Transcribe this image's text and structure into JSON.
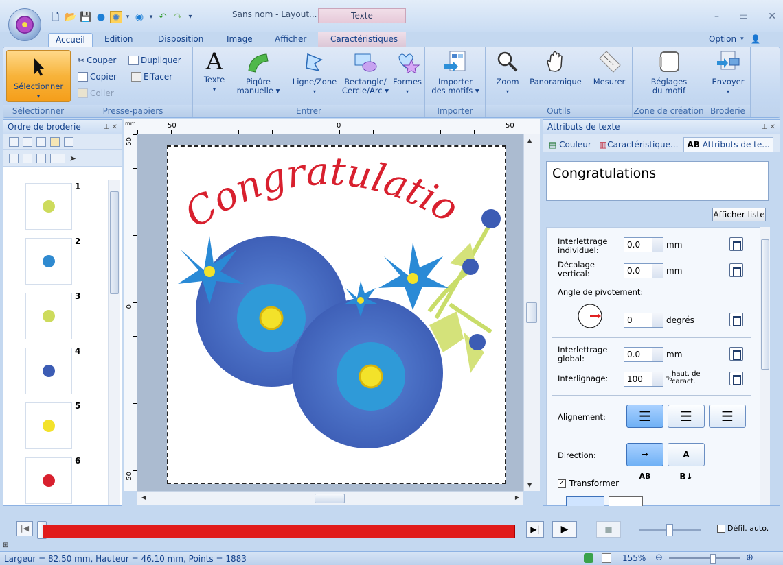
{
  "title_bar": {
    "document_title": "Sans nom - Layout...",
    "contextual_tab_group": "Texte"
  },
  "tabs": [
    "Accueil",
    "Edition",
    "Disposition",
    "Image",
    "Afficher",
    "Caractéristiques"
  ],
  "option_label": "Option",
  "ribbon": {
    "groups": {
      "selectionner": "Sélectionner",
      "presse_papiers": "Presse-papiers",
      "entrer": "Entrer",
      "importer": "Importer",
      "outils": "Outils",
      "zone_creation": "Zone de création",
      "broderie": "Broderie"
    },
    "buttons": {
      "selectionner": "Sélectionner",
      "couper": "Couper",
      "dupliquer": "Dupliquer",
      "copier": "Copier",
      "effacer": "Effacer",
      "coller": "Coller",
      "texte": "Texte",
      "piqure_1": "Piqûre",
      "piqure_2": "manuelle",
      "ligne_zone": "Ligne/Zone",
      "rectangle_1": "Rectangle/",
      "rectangle_2": "Cercle/Arc",
      "formes": "Formes",
      "importer_1": "Importer",
      "importer_2": "des motifs",
      "zoom": "Zoom",
      "panoramique": "Panoramique",
      "mesurer": "Mesurer",
      "reglages_1": "Réglages",
      "reglages_2": "du motif",
      "envoyer": "Envoyer"
    }
  },
  "left_panel": {
    "title": "Ordre de broderie",
    "items": [
      "1",
      "2",
      "3",
      "4",
      "5",
      "6"
    ]
  },
  "ruler": {
    "mm": "mm",
    "top_ticks": [
      "50",
      "0",
      "50"
    ],
    "left_ticks": [
      "50",
      "0",
      "50"
    ]
  },
  "canvas": {
    "embroidery_text": "Congratulations"
  },
  "right_panel": {
    "title": "Attributs de texte",
    "tabs": [
      "Couleur",
      "Caractéristique...",
      "Attributs de te..."
    ],
    "text_value": "Congratulations",
    "show_list_button": "Afficher liste",
    "properties": {
      "interlettrage_individuel_1": "Interlettrage",
      "interlettrage_individuel_2": "individuel:",
      "interlettrage_individuel_value": "0.0",
      "mm": "mm",
      "decalage_1": "Décalage",
      "decalage_2": "vertical:",
      "decalage_value": "0.0",
      "angle_label": "Angle de pivotement:",
      "angle_value": "0",
      "degres": "degrés",
      "interlettrage_global_1": "Interlettrage",
      "interlettrage_global_2": "global:",
      "interlettrage_global_value": "0.0",
      "interlignage_label": "Interlignage:",
      "interlignage_value": "100",
      "interlignage_unit_1": "haut. de",
      "interlignage_unit_2": "caract.",
      "percent": "%",
      "alignement_label": "Alignement:",
      "direction_label": "Direction:",
      "transformer_label": "Transformer"
    }
  },
  "player": {
    "defil_auto": "Défil. auto."
  },
  "status_bar": {
    "info": "Largeur = 82.50 mm, Hauteur = 46.10 mm, Points = 1883",
    "zoom": "155%"
  },
  "colors": {
    "accent_blue": "#15428b",
    "progress_red": "#e11b1b",
    "flower_blue": "#3f5fb5",
    "text_red": "#d8202e"
  }
}
